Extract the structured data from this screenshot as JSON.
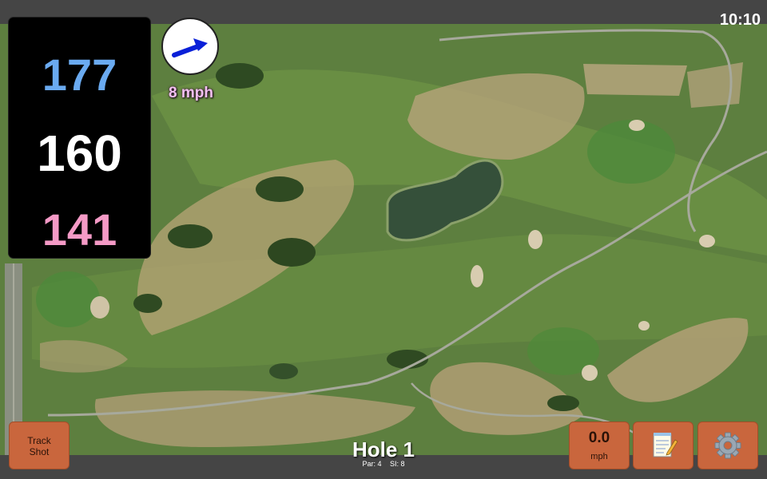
{
  "status_bar": {
    "time": "10:10"
  },
  "yardages": {
    "back": "177",
    "middle": "160",
    "front": "141"
  },
  "wind": {
    "speed_label": "8 mph",
    "direction_icon": "arrow-east-northeast"
  },
  "buttons": {
    "track_shot": {
      "line1": "Track",
      "line2": "Shot"
    },
    "wind_speed": {
      "value": "0.0",
      "unit": "mph"
    },
    "notes_icon": "notepad-icon",
    "settings_icon": "gear-icon"
  },
  "hole": {
    "title": "Hole 1",
    "par": "Par: 4",
    "si": "SI: 8"
  },
  "colors": {
    "back_yardage": "#6aaaf0",
    "middle_yardage": "#ffffff",
    "front_yardage": "#f49ac6",
    "button": "#c9663d",
    "wind_arrow": "#0a20d8"
  }
}
